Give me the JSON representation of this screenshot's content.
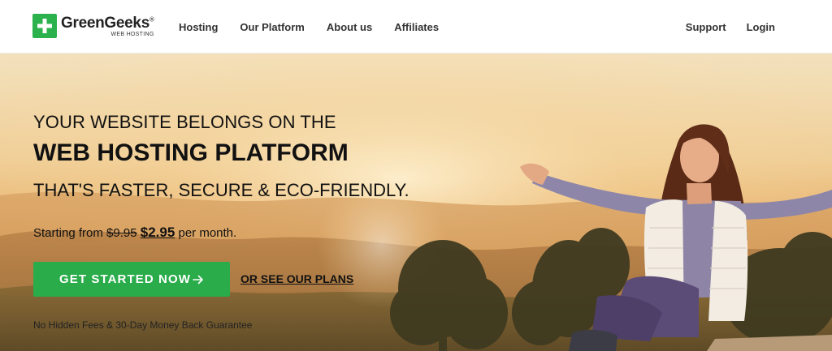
{
  "header": {
    "logo": {
      "name": "GreenGeeks",
      "registered": "®",
      "subtitle": "WEB HOSTING",
      "brand_color": "#2bb24c",
      "icon": "plus-icon"
    },
    "nav_left": [
      "Hosting",
      "Our Platform",
      "About us",
      "Affiliates"
    ],
    "nav_right": [
      "Support",
      "Login"
    ]
  },
  "hero": {
    "line1": "YOUR WEBSITE BELONGS ON THE",
    "line2": "WEB HOSTING PLATFORM",
    "line3": "THAT'S FASTER, SECURE & ECO-FRIENDLY.",
    "pricing": {
      "prefix": "Starting from",
      "old_price": "$9.95",
      "new_price": "$2.95",
      "suffix": "per month."
    },
    "cta_label": "GET STARTED NOW",
    "cta_icon": "arrow-right-icon",
    "cta_color": "#2aac4a",
    "plans_link": "OR SEE OUR PLANS",
    "guarantee": "No Hidden Fees & 30-Day Money Back Guarantee"
  }
}
